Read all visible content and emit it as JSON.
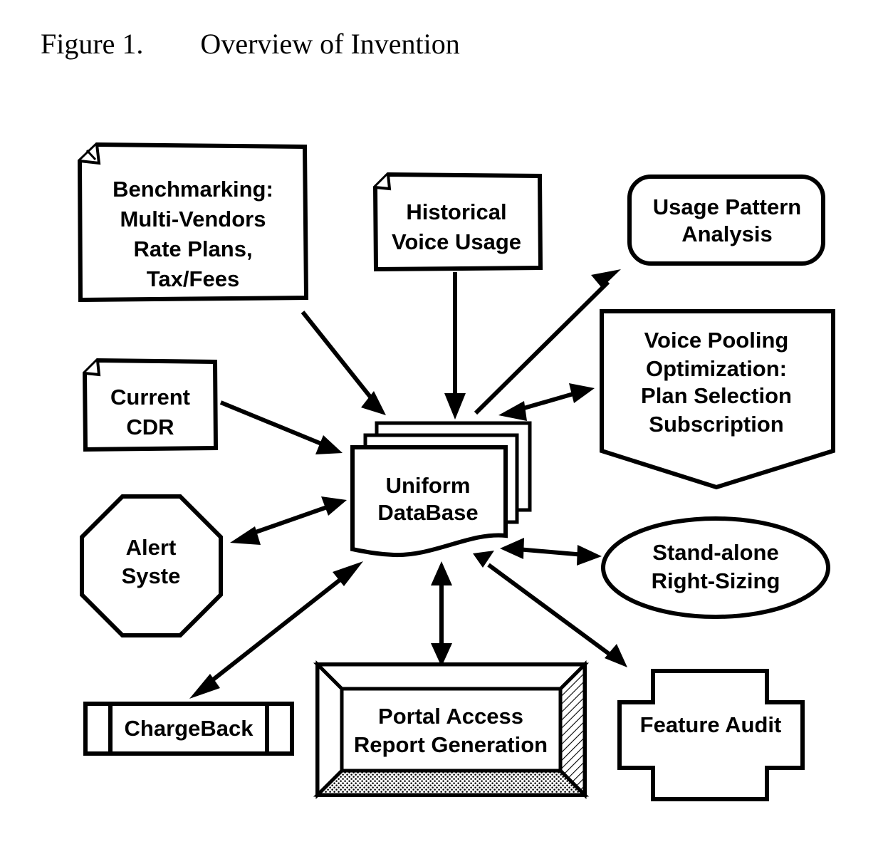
{
  "figure": {
    "label": "Figure 1.",
    "title": "Overview of Invention",
    "full_title": "Figure 1.        Overview of Invention"
  },
  "colors": {
    "ink": "#000000",
    "paper": "#ffffff"
  },
  "diagram_data": {
    "type": "diagram",
    "title": "Overview of Invention",
    "nodes": [
      {
        "id": "benchmarking",
        "shape": "document-folded-corner",
        "lines": [
          "Benchmarking:",
          "Multi-Vendors",
          "Rate Plans,",
          "Tax/Fees"
        ],
        "text": "Benchmarking: Multi-Vendors Rate Plans, Tax/Fees"
      },
      {
        "id": "historical-voice-usage",
        "shape": "document-folded-corner",
        "lines": [
          "Historical",
          "Voice Usage"
        ],
        "text": "Historical Voice Usage"
      },
      {
        "id": "usage-pattern-analysis",
        "shape": "rounded-rectangle",
        "lines": [
          "Usage Pattern",
          "Analysis"
        ],
        "text": "Usage Pattern Analysis"
      },
      {
        "id": "voice-pooling-optimization",
        "shape": "pentagon-down-notch",
        "lines": [
          "Voice Pooling",
          "Optimization:",
          "Plan Selection",
          "Subscription"
        ],
        "text": "Voice Pooling Optimization: Plan Selection Subscription"
      },
      {
        "id": "current-cdr",
        "shape": "document-folded-corner",
        "lines": [
          "Current",
          "CDR"
        ],
        "text": "Current CDR"
      },
      {
        "id": "uniform-database",
        "shape": "stacked-documents-wavy",
        "lines": [
          "Uniform",
          "DataBase"
        ],
        "text": "Uniform DataBase"
      },
      {
        "id": "alert-system",
        "shape": "octagon",
        "lines": [
          "Alert",
          "Syste"
        ],
        "text": "Alert Syste"
      },
      {
        "id": "stand-alone-right-sizing",
        "shape": "ellipse",
        "lines": [
          "Stand-alone",
          "Right-Sizing"
        ],
        "text": "Stand-alone Right-Sizing"
      },
      {
        "id": "chargeback",
        "shape": "predefined-process",
        "lines": [
          "ChargeBack"
        ],
        "text": "ChargeBack"
      },
      {
        "id": "portal-access-report-generation",
        "shape": "beveled-frame-3d",
        "lines": [
          "Portal Access",
          "Report Generation"
        ],
        "text": "Portal Access Report Generation"
      },
      {
        "id": "feature-audit",
        "shape": "cross",
        "lines": [
          "Feature Audit"
        ],
        "text": "Feature Audit"
      }
    ],
    "edges": [
      {
        "from": "benchmarking",
        "to": "uniform-database",
        "direction": "one-way"
      },
      {
        "from": "historical-voice-usage",
        "to": "uniform-database",
        "direction": "one-way"
      },
      {
        "from": "uniform-database",
        "to": "usage-pattern-analysis",
        "direction": "one-way"
      },
      {
        "from": "uniform-database",
        "to": "voice-pooling-optimization",
        "direction": "two-way"
      },
      {
        "from": "current-cdr",
        "to": "uniform-database",
        "direction": "one-way"
      },
      {
        "from": "alert-system",
        "to": "uniform-database",
        "direction": "two-way"
      },
      {
        "from": "uniform-database",
        "to": "stand-alone-right-sizing",
        "direction": "two-way"
      },
      {
        "from": "uniform-database",
        "to": "chargeback",
        "direction": "two-way"
      },
      {
        "from": "uniform-database",
        "to": "portal-access-report-generation",
        "direction": "two-way"
      },
      {
        "from": "uniform-database",
        "to": "feature-audit",
        "direction": "two-way"
      }
    ]
  },
  "labels": {
    "benchmarking": {
      "l1": "Benchmarking:",
      "l2": "Multi-Vendors",
      "l3": "Rate Plans,",
      "l4": "Tax/Fees"
    },
    "historical": {
      "l1": "Historical",
      "l2": "Voice Usage"
    },
    "usage_pattern": {
      "l1": "Usage Pattern",
      "l2": "Analysis"
    },
    "voice_pooling": {
      "l1": "Voice Pooling",
      "l2": "Optimization:",
      "l3": "Plan Selection",
      "l4": "Subscription"
    },
    "current_cdr": {
      "l1": "Current",
      "l2": "CDR"
    },
    "uniform_db": {
      "l1": "Uniform",
      "l2": "DataBase"
    },
    "alert": {
      "l1": "Alert",
      "l2": "Syste"
    },
    "right_sizing": {
      "l1": "Stand-alone",
      "l2": "Right-Sizing"
    },
    "chargeback": {
      "l1": "ChargeBack"
    },
    "portal": {
      "l1": "Portal Access",
      "l2": "Report Generation"
    },
    "feature_audit": {
      "l1": "Feature Audit"
    }
  }
}
